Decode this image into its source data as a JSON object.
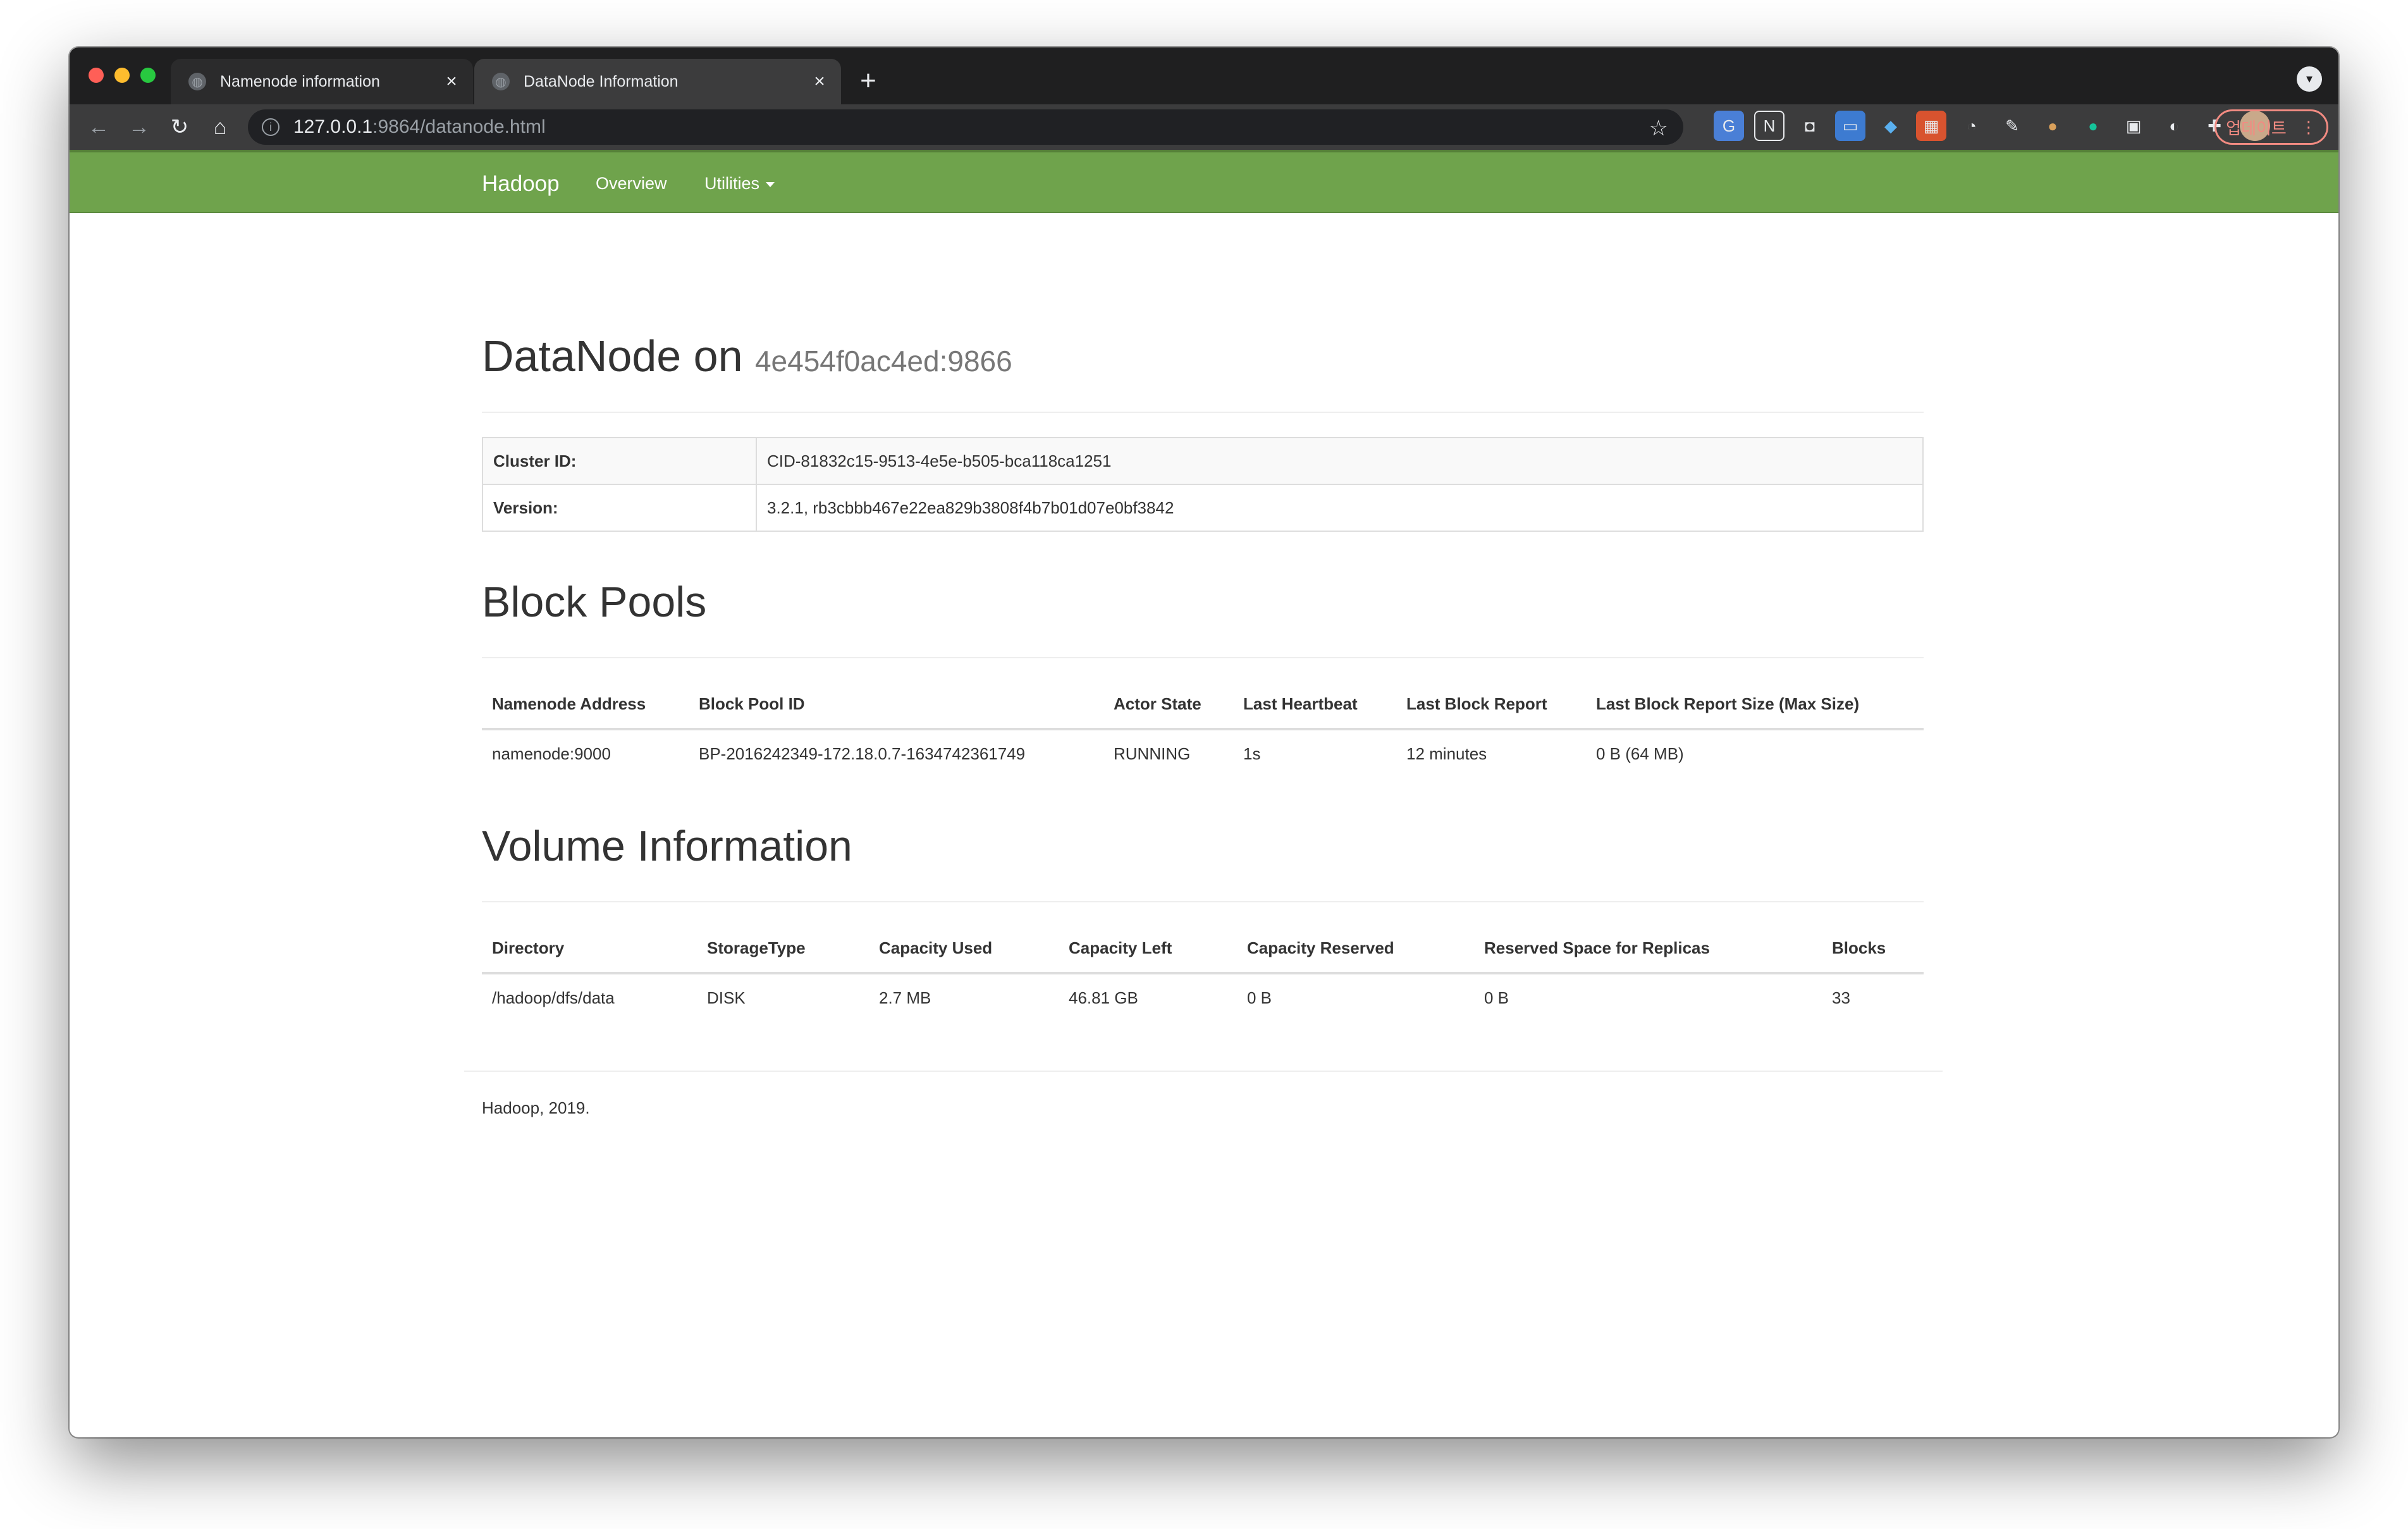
{
  "browser": {
    "tabs": [
      {
        "title": "Namenode information",
        "active": false
      },
      {
        "title": "DataNode Information",
        "active": true
      }
    ],
    "url_host": "127.0.0.1",
    "url_path": ":9864/datanode.html",
    "update_label": "업데이트"
  },
  "nav": {
    "brand": "Hadoop",
    "overview": "Overview",
    "utilities": "Utilities"
  },
  "header": {
    "title": "DataNode on",
    "host": "4e454f0ac4ed:9866"
  },
  "info": [
    {
      "key": "Cluster ID:",
      "value": "CID-81832c15-9513-4e5e-b505-bca118ca1251"
    },
    {
      "key": "Version:",
      "value": "3.2.1, rb3cbbb467e22ea829b3808f4b7b01d07e0bf3842"
    }
  ],
  "block_pools": {
    "title": "Block Pools",
    "columns": [
      "Namenode Address",
      "Block Pool ID",
      "Actor State",
      "Last Heartbeat",
      "Last Block Report",
      "Last Block Report Size (Max Size)"
    ],
    "rows": [
      [
        "namenode:9000",
        "BP-2016242349-172.18.0.7-1634742361749",
        "RUNNING",
        "1s",
        "12 minutes",
        "0 B (64 MB)"
      ]
    ]
  },
  "volumes": {
    "title": "Volume Information",
    "columns": [
      "Directory",
      "StorageType",
      "Capacity Used",
      "Capacity Left",
      "Capacity Reserved",
      "Reserved Space for Replicas",
      "Blocks"
    ],
    "rows": [
      [
        "/hadoop/dfs/data",
        "DISK",
        "2.7 MB",
        "46.81 GB",
        "0 B",
        "0 B",
        "33"
      ]
    ]
  },
  "footer": "Hadoop, 2019.",
  "colors": {
    "navbar": "#6fa34c",
    "browser_chrome": "#1f1f20"
  }
}
